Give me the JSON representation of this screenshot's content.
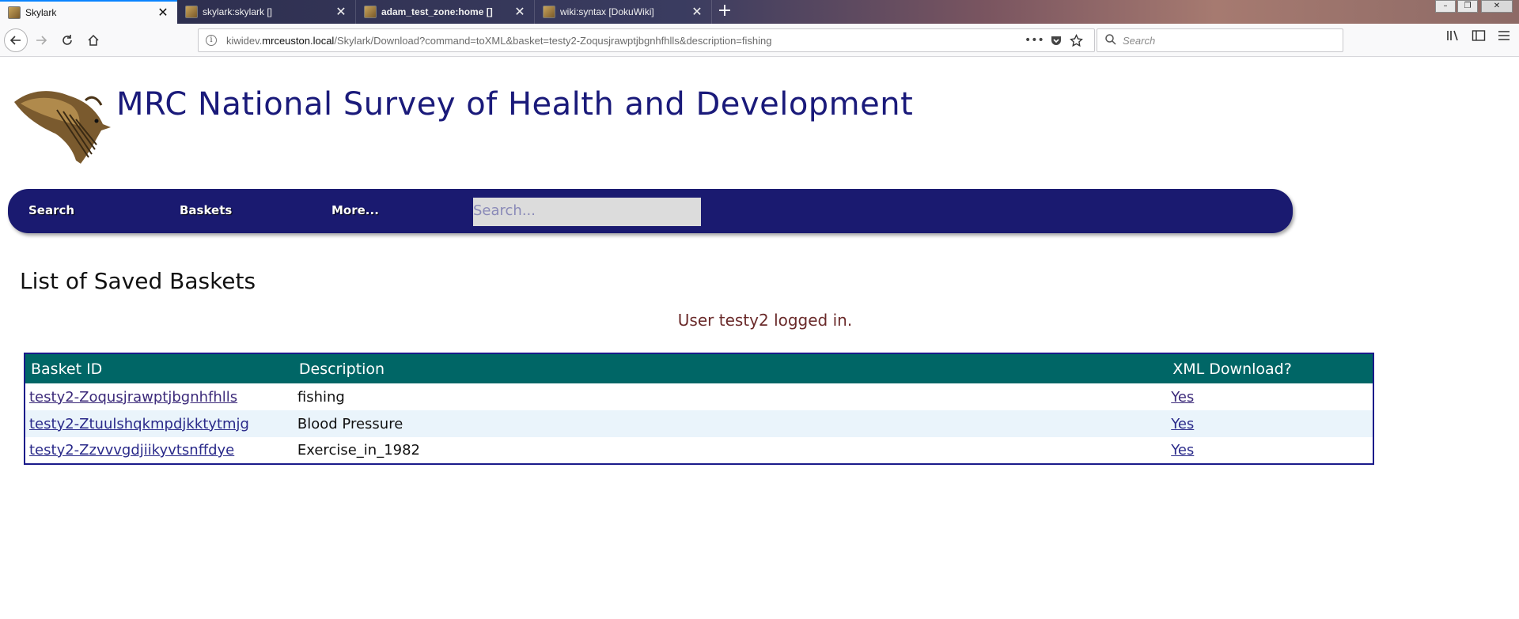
{
  "browser": {
    "tabs": [
      {
        "label": "Skylark",
        "active": true
      },
      {
        "label": "skylark:skylark []",
        "active": false
      },
      {
        "label": "adam_test_zone:home []",
        "active": false
      },
      {
        "label": "wiki:syntax [DokuWiki]",
        "active": false
      }
    ],
    "new_tab": "+",
    "close_glyph": "✕",
    "url": {
      "prefix": "kiwidev.",
      "domain": "mrceuston.local",
      "path": "/Skylark/Download?command=toXML&basket=testy2-Zoqusjrawptjbgnhfhlls&description=fishing"
    },
    "url_menu": "•••",
    "search_placeholder": "Search",
    "window_controls": [
      "–",
      "❐",
      "✕"
    ]
  },
  "site": {
    "title": "MRC National Survey of Health and Development",
    "nav": {
      "search_label": "Search",
      "baskets_label": "Baskets",
      "more_label": "More...",
      "search_placeholder": "Search..."
    }
  },
  "main": {
    "heading": "List of Saved Baskets",
    "login_message": "User testy2 logged in.",
    "table": {
      "columns": [
        "Basket ID",
        "Description",
        "XML Download?"
      ],
      "rows": [
        {
          "basket_id": "testy2-Zoqusjrawptjbgnhfhlls",
          "description": "fishing",
          "download": "Yes"
        },
        {
          "basket_id": "testy2-Ztuulshqkmpdjkktytmjg",
          "description": "Blood Pressure",
          "download": "Yes"
        },
        {
          "basket_id": "testy2-Zzvvvgdjiikyvtsnffdye",
          "description": "Exercise_in_1982",
          "download": "Yes"
        }
      ]
    }
  }
}
